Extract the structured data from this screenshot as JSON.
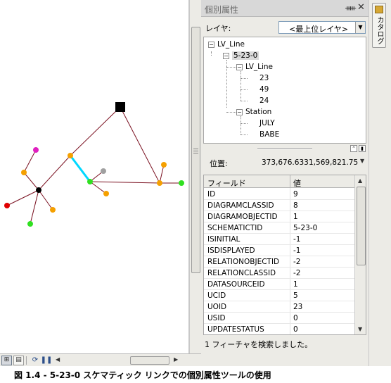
{
  "panel": {
    "title": "個別属性",
    "pin_icon": "pin-icon",
    "close_icon": "close-icon",
    "layer_label": "レイヤ:",
    "layer_value": "<最上位レイヤ>"
  },
  "tree": {
    "items": [
      {
        "label": "LV_Line",
        "toggle": "−"
      },
      {
        "label": "5-23-0",
        "toggle": "−"
      },
      {
        "label": "LV_Line",
        "toggle": "−"
      },
      {
        "label": "23"
      },
      {
        "label": "49"
      },
      {
        "label": "24"
      },
      {
        "label": "Station",
        "toggle": "−"
      },
      {
        "label": "JULY"
      },
      {
        "label": "BABE"
      }
    ]
  },
  "location": {
    "label": "位置:",
    "x": "373,676.633",
    "y": "1,569,821.75"
  },
  "table": {
    "headers": {
      "field": "フィールド",
      "value": "値"
    },
    "rows": [
      {
        "field": "ID",
        "value": "9"
      },
      {
        "field": "DIAGRAMCLASSID",
        "value": "8"
      },
      {
        "field": "DIAGRAMOBJECTID",
        "value": "1"
      },
      {
        "field": "SCHEMATICTID",
        "value": "5-23-0"
      },
      {
        "field": "ISINITIAL",
        "value": "-1"
      },
      {
        "field": "ISDISPLAYED",
        "value": "-1"
      },
      {
        "field": "RELATIONOBJECTID",
        "value": "-2"
      },
      {
        "field": "RELATIONCLASSID",
        "value": "-2"
      },
      {
        "field": "DATASOURCEID",
        "value": "1"
      },
      {
        "field": "UCID",
        "value": "5"
      },
      {
        "field": "UOID",
        "value": "23"
      },
      {
        "field": "USID",
        "value": "0"
      },
      {
        "field": "UPDATESTATUS",
        "value": "0"
      }
    ]
  },
  "status": "1 フィーチャを検索しました。",
  "catalog_tab": "カタログ",
  "caption": "図 1.4 - 5-23-0 スケマティック リンクでの個別属性ツールの使用",
  "colors": {
    "link": "#7a1020",
    "selected_link": "#00d8ff",
    "node_orange": "#f5a000",
    "node_green": "#30e020",
    "node_magenta": "#e020c0",
    "node_red": "#e00000",
    "node_gray": "#a0a0a0",
    "node_black": "#000000"
  }
}
